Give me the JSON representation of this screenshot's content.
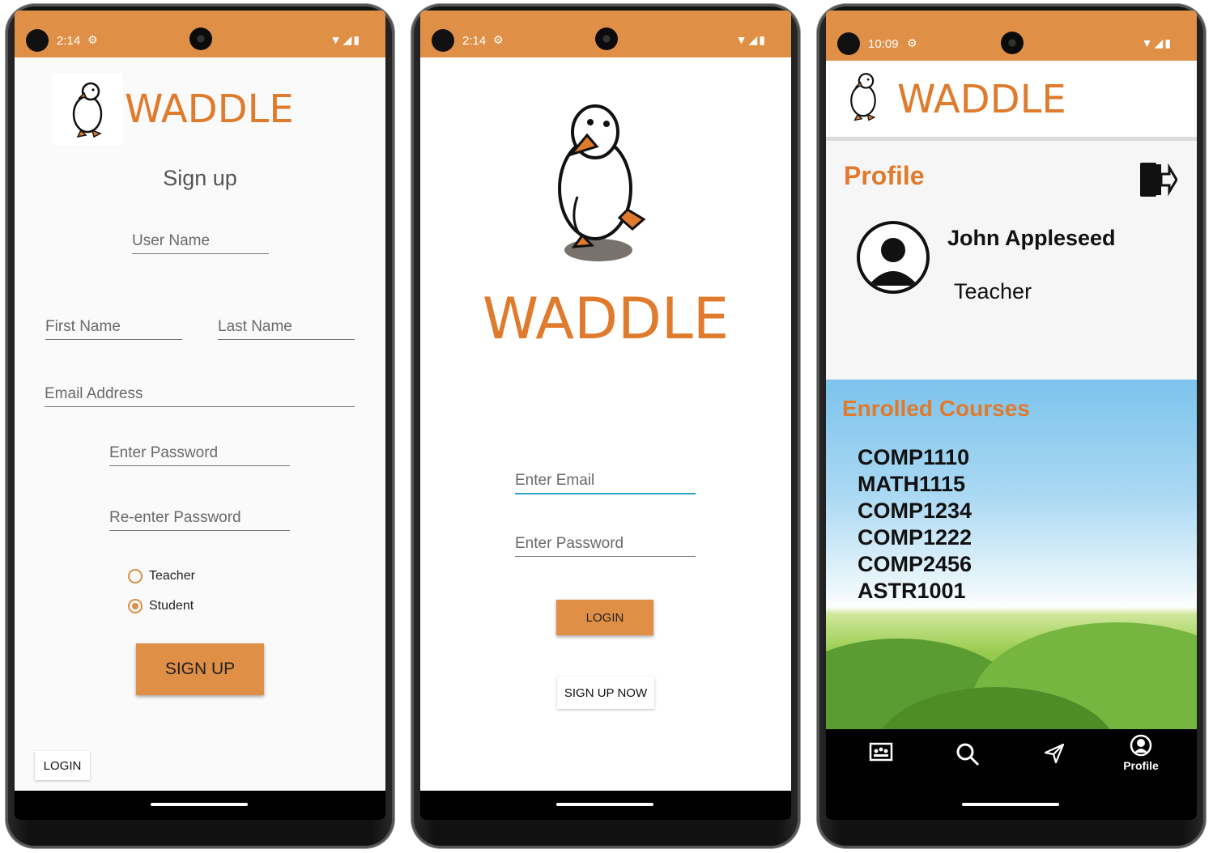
{
  "brand": {
    "name": "WADDLE",
    "color": "#e07a2c",
    "bar_color": "#e08f46",
    "mascot_icon": "duck-icon"
  },
  "phone1": {
    "status": {
      "time": "2:14"
    },
    "title": "Sign up",
    "fields": {
      "user_name": "User Name",
      "first_name": "First Name",
      "last_name": "Last Name",
      "email": "Email Address",
      "password": "Enter Password",
      "reenter_password": "Re-enter Password"
    },
    "roles": [
      {
        "label": "Teacher",
        "checked": false
      },
      {
        "label": "Student",
        "checked": true
      }
    ],
    "signup_button": "SIGN UP",
    "login_button": "LOGIN"
  },
  "phone2": {
    "status": {
      "time": "2:14"
    },
    "email_placeholder": "Enter Email",
    "password_placeholder": "Enter Password",
    "login_button": "LOGIN",
    "signup_button": "SIGN UP NOW"
  },
  "phone3": {
    "status": {
      "time": "10:09"
    },
    "profile_title": "Profile",
    "user": {
      "name": "John Appleseed",
      "role": "Teacher"
    },
    "courses_title": "Enrolled Courses",
    "courses": [
      "COMP1110",
      "MATH1115",
      "COMP1234",
      "COMP1222",
      "COMP2456",
      "ASTR1001"
    ],
    "tabs": [
      {
        "icon": "classroom-icon",
        "label": ""
      },
      {
        "icon": "search-icon",
        "label": ""
      },
      {
        "icon": "send-icon",
        "label": ""
      },
      {
        "icon": "profile-icon",
        "label": "Profile"
      }
    ]
  }
}
